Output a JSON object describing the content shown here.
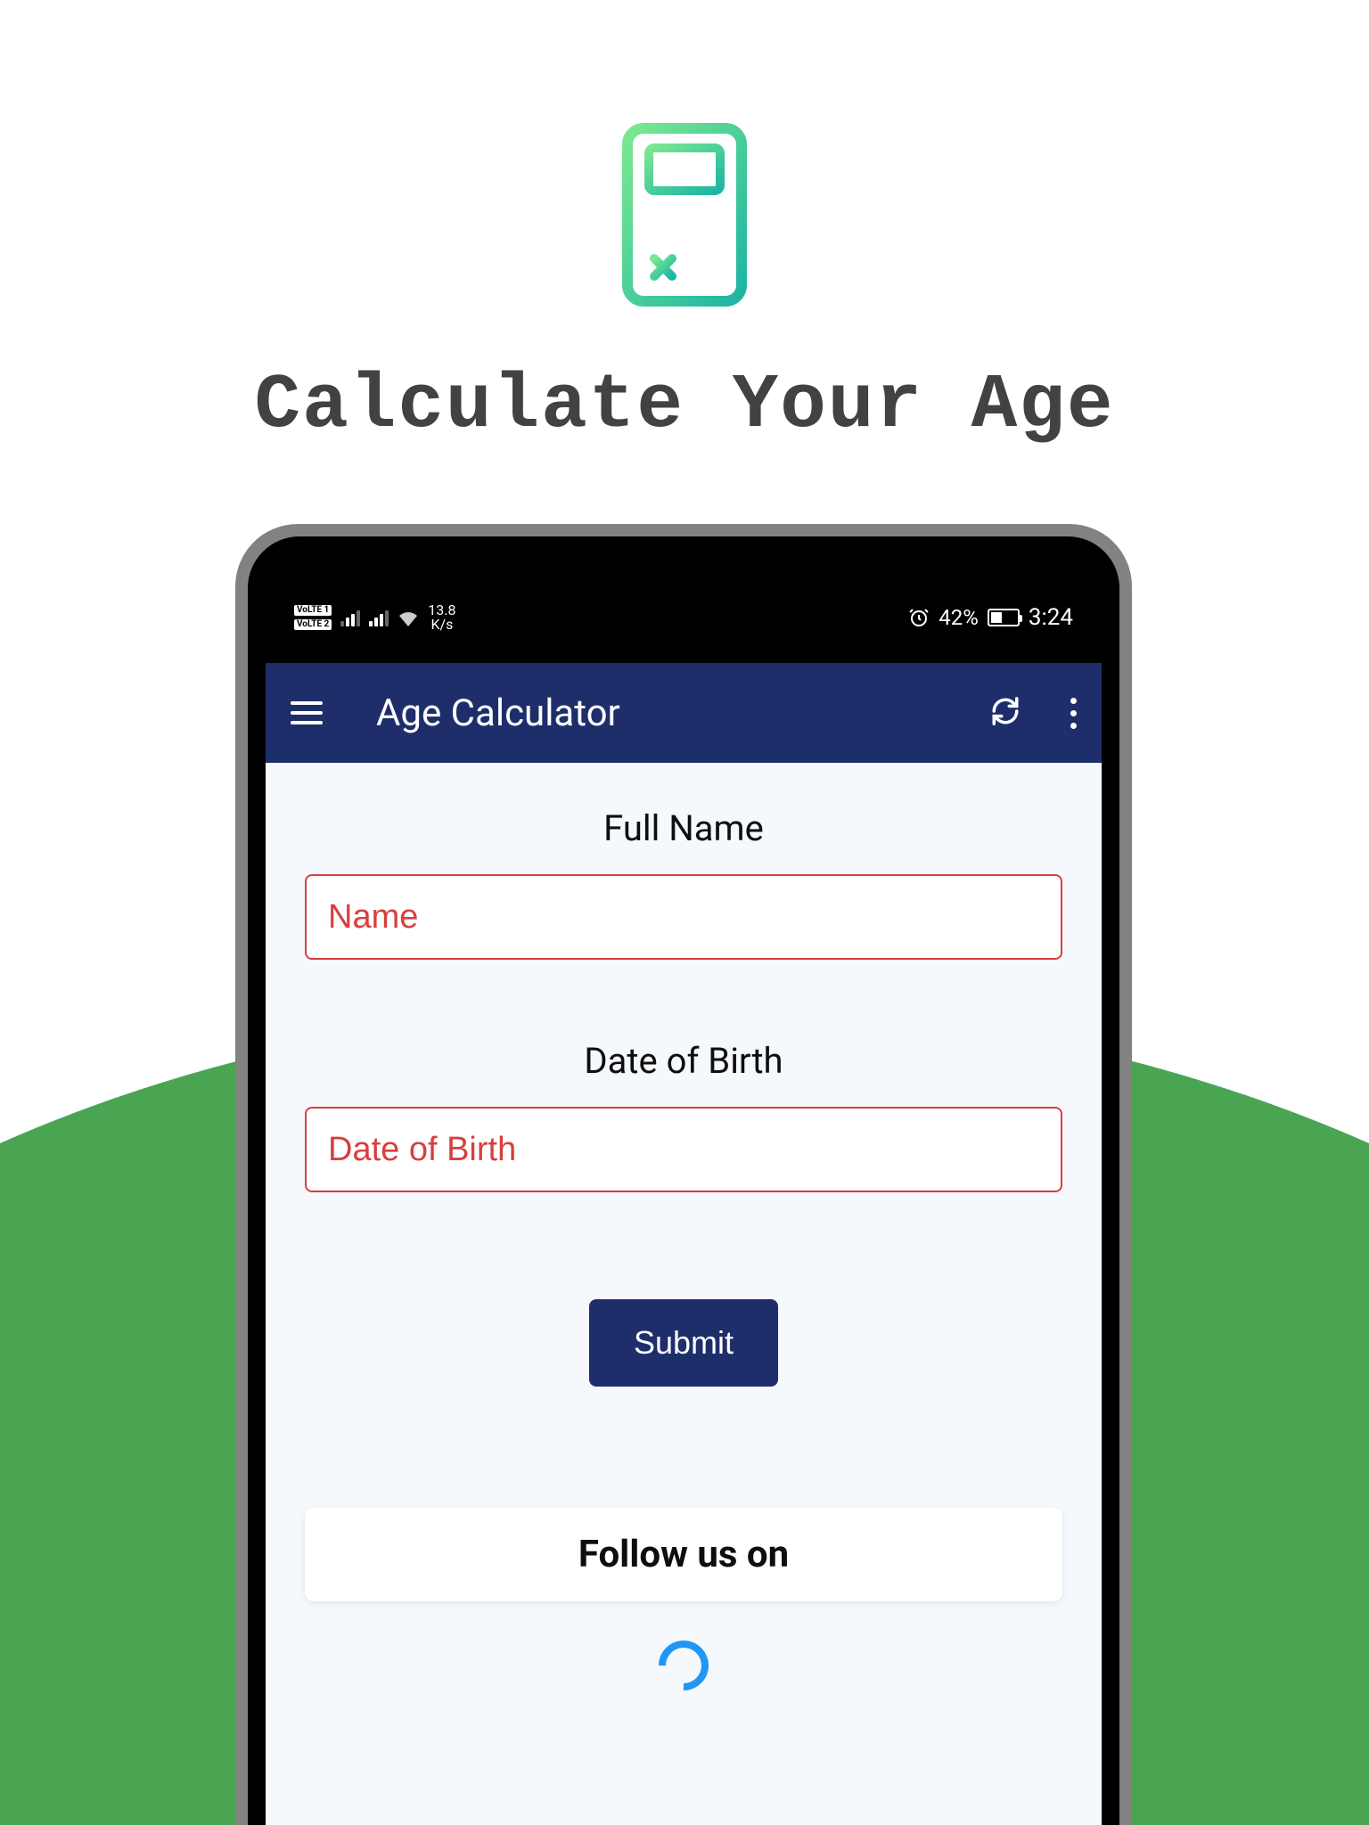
{
  "promo": {
    "title": "Calculate Your Age"
  },
  "status": {
    "volte1": "VoLTE 1",
    "volte2": "VoLTE 2",
    "speed": "13.8",
    "speed_unit": "K/s",
    "battery_pct": "42%",
    "time": "3:24"
  },
  "toolbar": {
    "title": "Age Calculator"
  },
  "form": {
    "name_label": "Full Name",
    "name_placeholder": "Name",
    "dob_label": "Date of Birth",
    "dob_placeholder": "Date of Birth",
    "submit_label": "Submit"
  },
  "footer": {
    "follow_label": "Follow us on"
  },
  "colors": {
    "toolbar_bg": "#1d2e6b",
    "accent_green": "#4aa553",
    "input_border": "#d93e3e",
    "spinner": "#2196f3"
  }
}
